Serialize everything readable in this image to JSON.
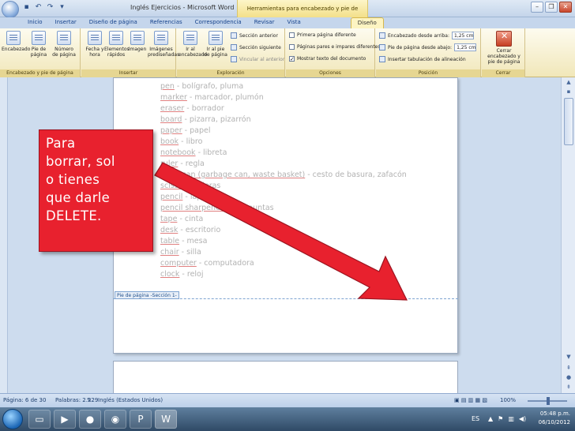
{
  "titlebar": {
    "document_title": "Inglés Ejercicios - Microsoft Word",
    "context_title": "Herramientas para encabezado y pie de página"
  },
  "tabs": [
    "Inicio",
    "Insertar",
    "Diseño de página",
    "Referencias",
    "Correspondencia",
    "Revisar",
    "Vista",
    "Diseño"
  ],
  "ribbon": {
    "groups": {
      "header_footer": "Encabezado y pie de página",
      "insert": "Insertar",
      "navigation": "Exploración",
      "options": "Opciones",
      "position": "Posición",
      "close": "Cerrar"
    },
    "buttons": {
      "header": "Encabezado",
      "footer": "Pie de página",
      "page_number": "Número de página",
      "date_time": "Fecha y hora",
      "quick_parts": "Elementos rápidos",
      "image": "Imagen",
      "clip_art": "Imágenes prediseñadas",
      "goto_header": "Ir al encabezado",
      "goto_footer": "Ir al pie de página",
      "prev_section": "Sección anterior",
      "next_section": "Sección siguiente",
      "link_previous": "Vincular al anterior",
      "different_first": "Primera página diferente",
      "different_odd_even": "Páginas pares e impares diferentes",
      "show_text": "Mostrar texto del documento",
      "header_from_top": "Encabezado desde arriba:",
      "header_from_top_value": "1,25 cm",
      "footer_from_bottom": "Pie de página desde abajo:",
      "footer_from_bottom_value": "1,25 cm",
      "insert_tab": "Insertar tabulación de alineación",
      "close_header_footer": "Cerrar encabezado y pie de página"
    }
  },
  "document": {
    "vocabulary": [
      [
        "pen",
        " - bolígrafo, pluma"
      ],
      [
        "marker",
        " - marcador, plumón"
      ],
      [
        "eraser",
        " - borrador"
      ],
      [
        "board",
        " - pizarra, pizarrón"
      ],
      [
        "paper",
        " - papel"
      ],
      [
        "book",
        " - libro"
      ],
      [
        "notebook",
        " - libreta"
      ],
      [
        "ruler",
        " - regla"
      ],
      [
        "trash can (garbage can, waste basket)",
        " - cesto de basura, zafacón"
      ],
      [
        "scissors",
        " - tijeras"
      ],
      [
        "pencil",
        " - lápiz"
      ],
      [
        "pencil sharpener",
        " - sacapuntas"
      ],
      [
        "tape",
        " - cinta"
      ],
      [
        "desk",
        " - escritorio"
      ],
      [
        "table",
        " - mesa"
      ],
      [
        "chair",
        " - silla"
      ],
      [
        "computer",
        " - computadora"
      ],
      [
        "clock",
        " - reloj"
      ]
    ],
    "footer_tag": "Pie de página -Sección 1-"
  },
  "callout": {
    "text": "Para borrar, solo tienes que darle DELETE.",
    "lines": [
      "Para",
      "borrar, sol",
      "o tienes",
      "que darle",
      "DELETE."
    ],
    "color": "#e8212e"
  },
  "statusbar": {
    "page": "Página: 6 de 30",
    "words": "Palabras: 2.229",
    "language": "Inglés (Estados Unidos)",
    "zoom": "100%"
  },
  "taskbar": {
    "lang": "ES",
    "time": "05:48 p.m.",
    "date": "06/10/2012"
  }
}
